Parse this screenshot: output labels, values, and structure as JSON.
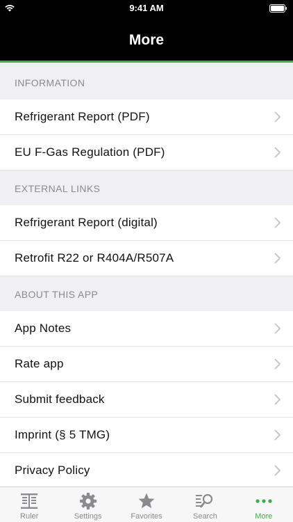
{
  "status_bar": {
    "time": "9:41 AM"
  },
  "navbar": {
    "title": "More"
  },
  "sections": [
    {
      "header": "INFORMATION",
      "items": [
        "Refrigerant Report (PDF)",
        "EU F-Gas Regulation (PDF)"
      ]
    },
    {
      "header": "EXTERNAL LINKS",
      "items": [
        "Refrigerant Report (digital)",
        "Retrofit R22 or R404A/R507A"
      ]
    },
    {
      "header": "ABOUT THIS APP",
      "items": [
        "App Notes",
        "Rate app",
        "Submit feedback",
        "Imprint (§ 5 TMG)",
        "Privacy Policy"
      ]
    }
  ],
  "tabbar": {
    "items": [
      {
        "label": "Ruler",
        "icon": "ruler-icon"
      },
      {
        "label": "Settings",
        "icon": "gear-icon"
      },
      {
        "label": "Favorites",
        "icon": "star-icon"
      },
      {
        "label": "Search",
        "icon": "search-icon"
      },
      {
        "label": "More",
        "icon": "more-dots-icon"
      }
    ],
    "active": "More"
  },
  "colors": {
    "accent": "#3fae49",
    "bar": "#000000",
    "background": "#efeff4"
  }
}
